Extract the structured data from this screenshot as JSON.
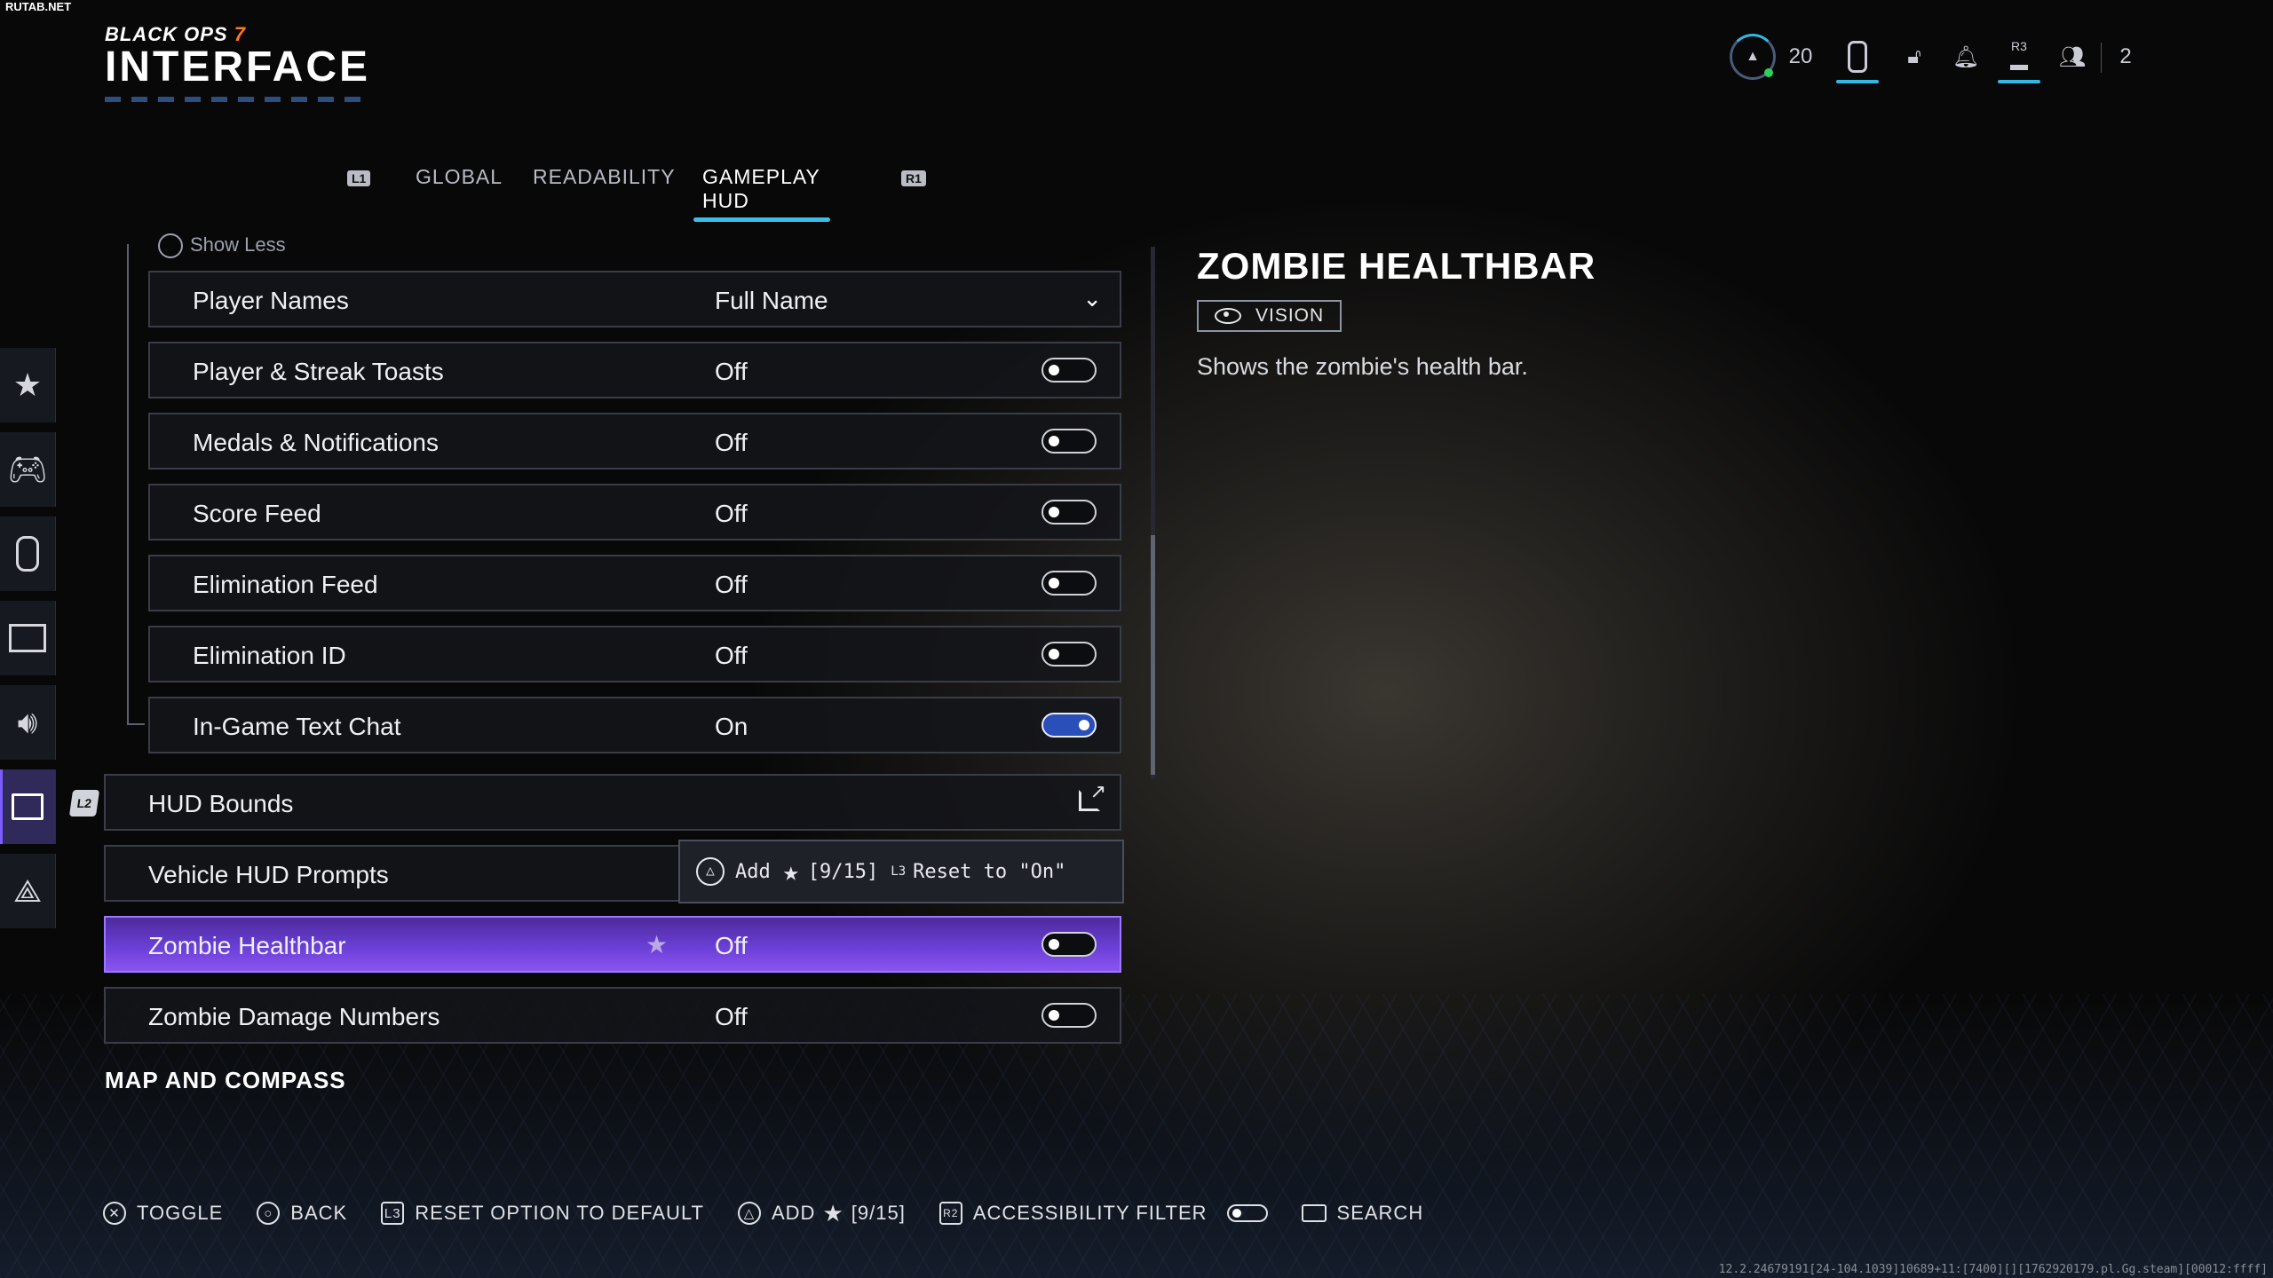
{
  "watermark": "RUTAB.NET",
  "header": {
    "brand_left": "BLACK OPS",
    "brand_num": "7",
    "page_title": "INTERFACE"
  },
  "topbar": {
    "level": "20",
    "party_count": "2",
    "r3_label": "R3"
  },
  "tabs": {
    "l1": "L1",
    "r1": "R1",
    "items": [
      {
        "label": "GLOBAL"
      },
      {
        "label": "READABILITY"
      },
      {
        "label": "GAMEPLAY HUD"
      }
    ],
    "active": "GAMEPLAY HUD"
  },
  "rail": {
    "l2": "L2"
  },
  "list": {
    "show_less": "Show Less",
    "rows": [
      {
        "label": "Player Names",
        "value": "Full Name"
      },
      {
        "label": "Player & Streak Toasts",
        "value": "Off"
      },
      {
        "label": "Medals & Notifications",
        "value": "Off"
      },
      {
        "label": "Score Feed",
        "value": "Off"
      },
      {
        "label": "Elimination Feed",
        "value": "Off"
      },
      {
        "label": "Elimination ID",
        "value": "Off"
      },
      {
        "label": "In-Game Text Chat",
        "value": "On"
      },
      {
        "label": "HUD Bounds",
        "value": ""
      },
      {
        "label": "Vehicle HUD Prompts",
        "value": ""
      },
      {
        "label": "Zombie Healthbar",
        "value": "Off"
      },
      {
        "label": "Zombie Damage Numbers",
        "value": "Off"
      }
    ],
    "section_next": "MAP AND COMPASS"
  },
  "tooltip": {
    "add": "Add",
    "count": "[9/15]",
    "l3": "L3",
    "reset": "Reset to \"On\""
  },
  "detail": {
    "title": "ZOMBIE HEALTHBAR",
    "tag": "VISION",
    "description": "Shows the zombie's health bar."
  },
  "footer": {
    "toggle": "TOGGLE",
    "back": "BACK",
    "reset": "RESET OPTION TO DEFAULT",
    "add": "ADD",
    "add_count": "[9/15]",
    "r2": "R2",
    "filter": "ACCESSIBILITY FILTER",
    "search": "SEARCH"
  },
  "build_info": "12.2.24679191[24-104.1039]10689+11:[7400][][1762920179.pl.Gg.steam][00012:ffff]",
  "colors": {
    "accent": "#3ac0e8",
    "highlight": "#6a3fd6",
    "toggle_on": "#2b4fb8"
  }
}
